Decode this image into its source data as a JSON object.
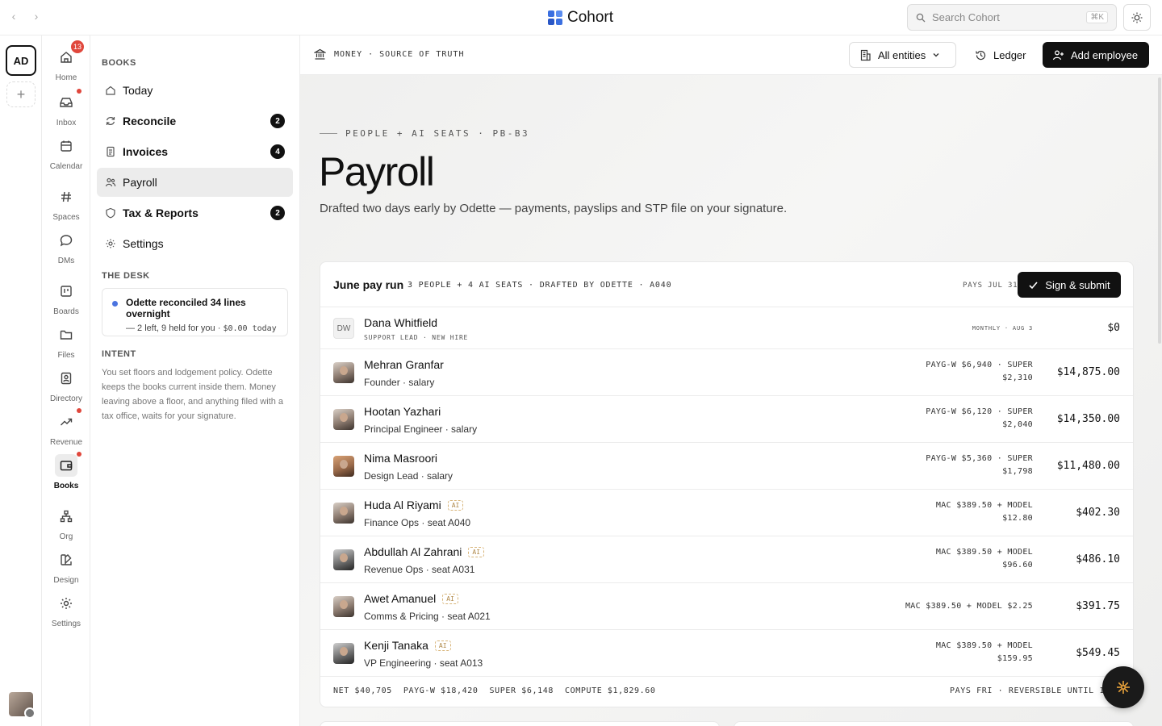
{
  "topbar": {
    "brand": "Cohort",
    "search_placeholder": "Search Cohort",
    "search_shortcut": "⌘K"
  },
  "rail": {
    "workspace_initials": "AD"
  },
  "appnav": {
    "items": [
      {
        "label": "Home",
        "icon": "home-icon",
        "badge": "13"
      },
      {
        "label": "Inbox",
        "icon": "inbox-icon",
        "dot": true
      },
      {
        "label": "Calendar",
        "icon": "calendar-icon"
      },
      {
        "label": "Spaces",
        "icon": "hash-icon"
      },
      {
        "label": "DMs",
        "icon": "chat-icon"
      },
      {
        "label": "Boards",
        "icon": "board-icon"
      },
      {
        "label": "Files",
        "icon": "folder-icon"
      },
      {
        "label": "Directory",
        "icon": "contact-icon"
      },
      {
        "label": "Revenue",
        "icon": "trend-icon",
        "dot": true
      },
      {
        "label": "Books",
        "icon": "wallet-icon",
        "dot": true,
        "active": true
      },
      {
        "label": "Org",
        "icon": "org-icon"
      },
      {
        "label": "Design",
        "icon": "design-icon"
      },
      {
        "label": "Settings",
        "icon": "gear-icon"
      }
    ]
  },
  "sidebar": {
    "heading": "BOOKS",
    "items": [
      {
        "label": "Today",
        "icon": "home-icon"
      },
      {
        "label": "Reconcile",
        "icon": "refresh-icon",
        "count": "2"
      },
      {
        "label": "Invoices",
        "icon": "document-icon",
        "count": "4"
      },
      {
        "label": "Payroll",
        "icon": "people-icon",
        "active": true
      },
      {
        "label": "Tax & Reports",
        "icon": "shield-icon",
        "count": "2"
      },
      {
        "label": "Settings",
        "icon": "gear-icon"
      }
    ],
    "desk_heading": "THE DESK",
    "desk_title": "Odette reconciled 34 lines overnight",
    "desk_sub": "— 2 left, 9 held for you · ",
    "desk_sub_mono": "$0.00 today",
    "intent_heading": "INTENT",
    "intent_text": "You set floors and lodgement policy. Odette keeps the books current inside them. Money leaving above a floor, and anything filed with a tax office, waits for your signature."
  },
  "header": {
    "crumb": "MONEY · SOURCE OF TRUTH",
    "entities": "All entities",
    "ledger": "Ledger",
    "add_employee": "Add employee"
  },
  "page": {
    "eyebrow": "PEOPLE + AI SEATS · PB-B3",
    "title": "Payroll",
    "subtitle": "Drafted two days early by Odette — payments, payslips and STP file on your signature."
  },
  "run": {
    "title": "June pay run",
    "meta": "3 PEOPLE + 4 AI SEATS · DRAFTED BY ODETTE · A040",
    "pays": "PAYS JUL 31",
    "sign": "Sign & submit",
    "rows": [
      {
        "initials": "DW",
        "name": "Dana Whitfield",
        "role": "SUPPORT LEAD · NEW HIRE",
        "detail": "MONTHLY · AUG 3",
        "amount": "$0"
      },
      {
        "name": "Mehran Granfar",
        "role": "Founder · salary",
        "detail1": "PAYG-W $6,940 · SUPER",
        "detail2": "$2,310",
        "amount": "$14,875.00"
      },
      {
        "name": "Hootan Yazhari",
        "role": "Principal Engineer · salary",
        "detail1": "PAYG-W $6,120 · SUPER",
        "detail2": "$2,040",
        "amount": "$14,350.00"
      },
      {
        "name": "Nima Masroori",
        "role": "Design Lead · salary",
        "detail1": "PAYG-W $5,360 · SUPER",
        "detail2": "$1,798",
        "amount": "$11,480.00"
      },
      {
        "name": "Huda Al Riyami",
        "ai": "AI",
        "role": "Finance Ops · seat A040",
        "detail1": "MAC $389.50 + MODEL",
        "detail2": "$12.80",
        "amount": "$402.30"
      },
      {
        "name": "Abdullah Al Zahrani",
        "ai": "AI",
        "role": "Revenue Ops · seat A031",
        "detail1": "MAC $389.50 + MODEL",
        "detail2": "$96.60",
        "amount": "$486.10"
      },
      {
        "name": "Awet Amanuel",
        "ai": "AI",
        "role": "Comms & Pricing · seat A021",
        "detail": "MAC $389.50 + MODEL $2.25",
        "amount": "$391.75"
      },
      {
        "name": "Kenji Tanaka",
        "ai": "AI",
        "role": "VP Engineering · seat A013",
        "detail1": "MAC $389.50 + MODEL",
        "detail2": "$159.95",
        "amount": "$549.45"
      }
    ],
    "footer": {
      "net": "NET $40,705",
      "payg": "PAYG-W $18,420",
      "super": "SUPER $6,148",
      "compute": "COMPUTE $1,829.60",
      "right": "PAYS FRI · REVERSIBLE UNTIL 15"
    }
  },
  "colors": {
    "accent": "#111111",
    "badge": "#e0473c",
    "brand": "#3b6fe0",
    "ai_tag": "#b0894a"
  }
}
